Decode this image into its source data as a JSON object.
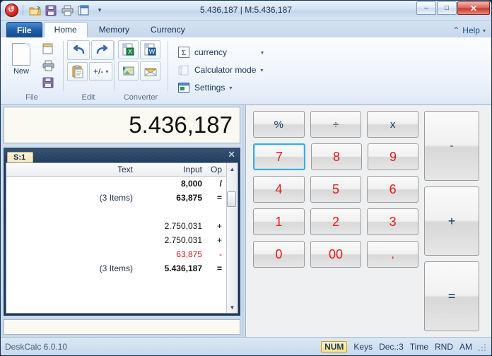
{
  "window": {
    "title": "5.436,187 | M:5.436,187",
    "minimize_label": "–",
    "maximize_label": "□",
    "close_label": "✕"
  },
  "quick_access": {
    "items": [
      {
        "name": "app-logo",
        "label": "↺"
      },
      {
        "name": "open-icon",
        "label": ""
      },
      {
        "name": "save-icon",
        "label": ""
      },
      {
        "name": "print-icon",
        "label": ""
      },
      {
        "name": "new-window-icon",
        "label": ""
      },
      {
        "name": "qat-dropdown-icon",
        "label": "▾"
      }
    ]
  },
  "tabs": [
    {
      "label": "File",
      "active": false,
      "file": true
    },
    {
      "label": "Home",
      "active": true,
      "file": false
    },
    {
      "label": "Memory",
      "active": false,
      "file": false
    },
    {
      "label": "Currency",
      "active": false,
      "file": false
    }
  ],
  "help": {
    "label": "Help",
    "chevron": "⌃",
    "caret": "▾"
  },
  "ribbon": {
    "groups": [
      {
        "name": "file",
        "label": "File",
        "big_button": {
          "label": "New"
        },
        "small_buttons": [
          {
            "name": "open-document-icon"
          },
          {
            "name": "print-icon"
          },
          {
            "name": "save-icon"
          }
        ]
      },
      {
        "name": "edit",
        "label": "Edit",
        "undo": "↶",
        "redo": "↷",
        "paste_name": "paste-icon",
        "sign_toggle_label": "+/-",
        "sign_toggle_caret": "▾"
      },
      {
        "name": "converter",
        "label": "Converter",
        "buttons": [
          {
            "name": "export-excel-icon",
            "glyph": "X"
          },
          {
            "name": "export-word-icon",
            "glyph": "W"
          },
          {
            "name": "export-image-icon",
            "glyph": ""
          },
          {
            "name": "send-email-icon",
            "glyph": ""
          }
        ]
      },
      {
        "name": "options",
        "label": "",
        "menu": [
          {
            "name": "currency-menu",
            "label": "currency",
            "icon": "Σ",
            "caret": "▾",
            "caret_far": true
          },
          {
            "name": "calculator-mode-menu",
            "label": "Calculator mode",
            "icon": "",
            "caret": "▾",
            "caret_far": false
          },
          {
            "name": "settings-menu",
            "label": "Settings",
            "icon": "",
            "caret": "▾",
            "caret_far": false
          }
        ]
      }
    ]
  },
  "display": {
    "value": "5.436,187"
  },
  "tape": {
    "sheet_tab": "S:1",
    "close_label": "✕",
    "columns": {
      "text": "Text",
      "input": "Input",
      "op": "Op"
    },
    "rows": [
      {
        "text": "",
        "input": "8,000",
        "op": "/",
        "bold": false,
        "red": false
      },
      {
        "text": "(3 Items)",
        "input": "63,875",
        "op": "=",
        "bold": true,
        "red": false
      },
      {
        "text": "",
        "input": "",
        "op": "",
        "bold": false,
        "red": false
      },
      {
        "text": "",
        "input": "2.750,031",
        "op": "+",
        "bold": false,
        "red": false
      },
      {
        "text": "",
        "input": "2.750,031",
        "op": "+",
        "bold": false,
        "red": false
      },
      {
        "text": "",
        "input": "63,875",
        "op": "-",
        "bold": false,
        "red": true
      },
      {
        "text": "(3 Items)",
        "input": "5.436,187",
        "op": "=",
        "bold": true,
        "red": false
      }
    ],
    "scroll_up": "▲",
    "scroll_down": "▼"
  },
  "keypad": {
    "rows": [
      [
        {
          "label": "%",
          "type": "op"
        },
        {
          "label": "÷",
          "type": "op"
        },
        {
          "label": "x",
          "type": "op"
        }
      ],
      [
        {
          "label": "7",
          "type": "num",
          "focus": true
        },
        {
          "label": "8",
          "type": "num",
          "focus": false
        },
        {
          "label": "9",
          "type": "num",
          "focus": false
        }
      ],
      [
        {
          "label": "4",
          "type": "num",
          "focus": false
        },
        {
          "label": "5",
          "type": "num",
          "focus": false
        },
        {
          "label": "6",
          "type": "num",
          "focus": false
        }
      ],
      [
        {
          "label": "1",
          "type": "num",
          "focus": false
        },
        {
          "label": "2",
          "type": "num",
          "focus": false
        },
        {
          "label": "3",
          "type": "num",
          "focus": false
        }
      ],
      [
        {
          "label": "0",
          "type": "num",
          "focus": false
        },
        {
          "label": "00",
          "type": "num",
          "focus": false
        },
        {
          "label": ",",
          "type": "num",
          "focus": false
        }
      ]
    ],
    "side": [
      {
        "label": "-",
        "type": "op"
      },
      {
        "label": "+",
        "type": "op"
      },
      {
        "label": "=",
        "type": "op"
      }
    ]
  },
  "status": {
    "app_version": "DeskCalc 6.0.10",
    "indicators": [
      {
        "label": "NUM",
        "highlight": true
      },
      {
        "label": "Keys",
        "highlight": false
      },
      {
        "label": "Dec.:3",
        "highlight": false
      },
      {
        "label": "Time",
        "highlight": false
      },
      {
        "label": "RND",
        "highlight": false
      },
      {
        "label": "AM",
        "highlight": false
      }
    ]
  },
  "colors": {
    "accent_blue": "#1f5ea8",
    "digit_red": "#e01b1b",
    "operator_navy": "#13325c",
    "tape_header": "#203a5c",
    "display_bg": "#fbfaf2",
    "highlight_yellow": "#ffe38a"
  }
}
